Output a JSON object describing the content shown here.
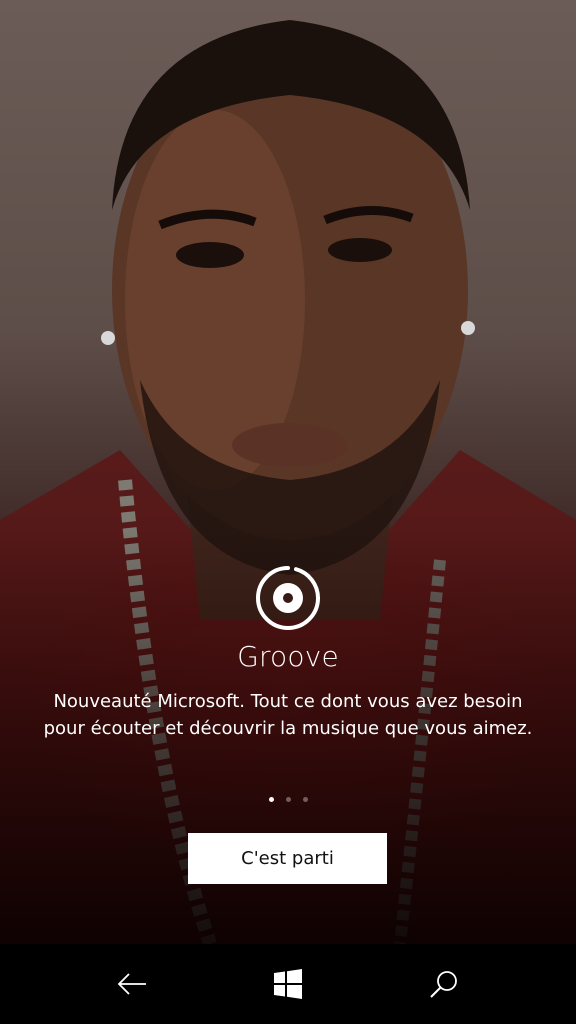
{
  "app": {
    "name": "Groove",
    "description_line1": "Nouveauté Microsoft. Tout ce dont vous avez besoin",
    "description_line2": "pour écouter et découvrir la musique que vous aimez.",
    "logo_icon": "groove-disc-icon"
  },
  "pager": {
    "total": 3,
    "active_index": 0
  },
  "cta": {
    "label": "C'est parti"
  },
  "navbar": {
    "back_icon": "back-arrow-icon",
    "start_icon": "windows-logo-icon",
    "search_icon": "search-icon"
  },
  "colors": {
    "text": "#ffffff",
    "button_bg": "#ffffff",
    "button_text": "#111111",
    "navbar_bg": "#000000"
  }
}
